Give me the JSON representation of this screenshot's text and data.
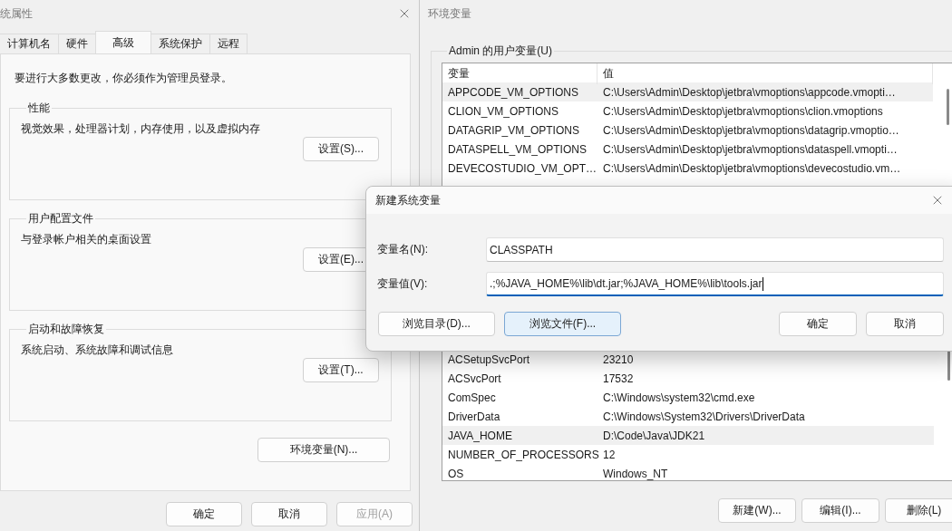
{
  "system_properties": {
    "title": "统属性",
    "tabs": [
      {
        "label": "计算机名",
        "selected": false
      },
      {
        "label": "硬件",
        "selected": false
      },
      {
        "label": "高级",
        "selected": true
      },
      {
        "label": "系统保护",
        "selected": false
      },
      {
        "label": "远程",
        "selected": false
      }
    ],
    "notice": "要进行大多数更改，你必须作为管理员登录。",
    "groups": [
      {
        "title": "性能",
        "description": "视觉效果，处理器计划，内存使用，以及虚拟内存",
        "button": "设置(S)..."
      },
      {
        "title": "用户配置文件",
        "description": "与登录帐户相关的桌面设置",
        "button": "设置(E)..."
      },
      {
        "title": "启动和故障恢复",
        "description": "系统启动、系统故障和调试信息",
        "button": "设置(T)..."
      }
    ],
    "env_button": "环境变量(N)...",
    "buttons": [
      {
        "label": "确定",
        "disabled": false
      },
      {
        "label": "取消",
        "disabled": false
      },
      {
        "label": "应用(A)",
        "disabled": true
      }
    ]
  },
  "environment_variables": {
    "title": "环境变量",
    "user_group": "Admin 的用户变量(U)",
    "columns": [
      "变量",
      "值"
    ],
    "user_rows": [
      {
        "name": "APPCODE_VM_OPTIONS",
        "value": "C:\\Users\\Admin\\Desktop\\jetbra\\vmoptions\\appcode.vmopti…",
        "selected": true
      },
      {
        "name": "CLION_VM_OPTIONS",
        "value": "C:\\Users\\Admin\\Desktop\\jetbra\\vmoptions\\clion.vmoptions",
        "selected": false
      },
      {
        "name": "DATAGRIP_VM_OPTIONS",
        "value": "C:\\Users\\Admin\\Desktop\\jetbra\\vmoptions\\datagrip.vmoptio…",
        "selected": false
      },
      {
        "name": "DATASPELL_VM_OPTIONS",
        "value": "C:\\Users\\Admin\\Desktop\\jetbra\\vmoptions\\dataspell.vmopti…",
        "selected": false
      },
      {
        "name": "DEVECOSTUDIO_VM_OPT…",
        "value": "C:\\Users\\Admin\\Desktop\\jetbra\\vmoptions\\devecostudio.vm…",
        "selected": false
      }
    ],
    "system_rows": [
      {
        "name": "ACSetupSvcPort",
        "value": "23210",
        "selected": false
      },
      {
        "name": "ACSvcPort",
        "value": "17532",
        "selected": false
      },
      {
        "name": "ComSpec",
        "value": "C:\\Windows\\system32\\cmd.exe",
        "selected": false
      },
      {
        "name": "DriverData",
        "value": "C:\\Windows\\System32\\Drivers\\DriverData",
        "selected": false
      },
      {
        "name": "JAVA_HOME",
        "value": "D:\\Code\\Java\\JDK21",
        "selected": true
      },
      {
        "name": "NUMBER_OF_PROCESSORS",
        "value": "12",
        "selected": false
      },
      {
        "name": "OS",
        "value": "Windows_NT",
        "selected": false
      }
    ],
    "buttons": [
      "新建(W)...",
      "编辑(I)...",
      "删除(L)"
    ]
  },
  "new_variable_dialog": {
    "title": "新建系统变量",
    "fields": [
      {
        "label": "变量名(N):",
        "value": "CLASSPATH",
        "focused": false
      },
      {
        "label": "变量值(V):",
        "value": ".;%JAVA_HOME%\\lib\\dt.jar;%JAVA_HOME%\\lib\\tools.jar",
        "focused": true
      }
    ],
    "browse_buttons": [
      {
        "label": "浏览目录(D)...",
        "highlighted": false
      },
      {
        "label": "浏览文件(F)...",
        "highlighted": true
      }
    ],
    "buttons": [
      "确定",
      "取消"
    ]
  }
}
